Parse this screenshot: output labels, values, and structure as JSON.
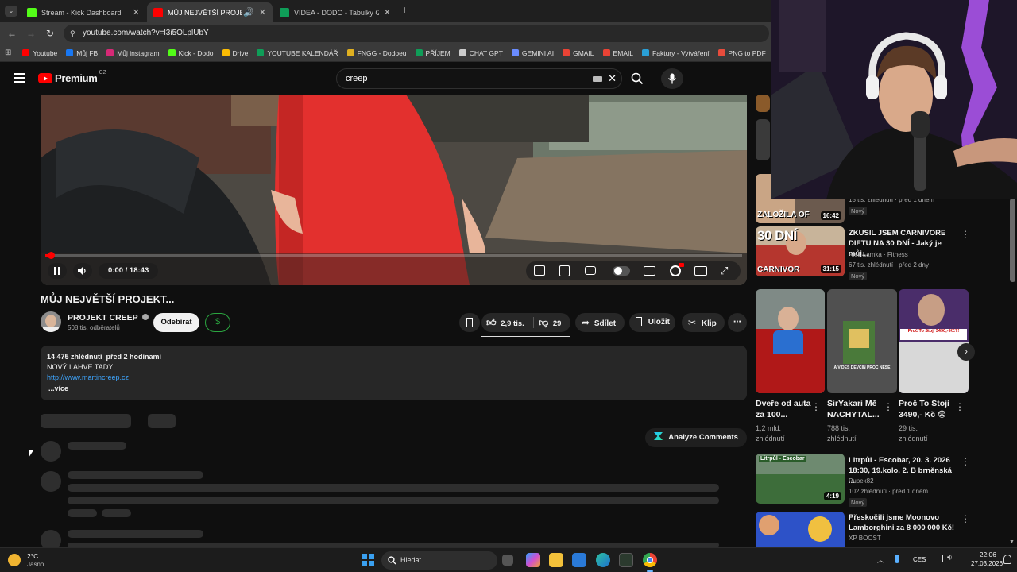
{
  "browser": {
    "tabs": [
      {
        "label": "Stream - Kick Dashboard",
        "color": "#53fc18"
      },
      {
        "label": "MŮJ NEJVĚTŠÍ PROJEKT...",
        "color": "#ff0000"
      },
      {
        "label": "VIDEA - DODO - Tabulky Googl",
        "color": "#0f9d58"
      }
    ],
    "new_tab": "+",
    "url": "youtube.com/watch?v=l3i5OLplUbY",
    "bookmarks": [
      {
        "label": "Youtube",
        "color": "#ff0000"
      },
      {
        "label": "Můj FB",
        "color": "#1877f2"
      },
      {
        "label": "Můj instagram",
        "color": "#d62976"
      },
      {
        "label": "Kick - Dodo",
        "color": "#53fc18"
      },
      {
        "label": "Drive",
        "color": "#fbbc04"
      },
      {
        "label": "YOUTUBE KALENDÁŘ",
        "color": "#0f9d58"
      },
      {
        "label": "FNGG - Dodoeu",
        "color": "#e0b020"
      },
      {
        "label": "PŘÍJEM",
        "color": "#0f9d58"
      },
      {
        "label": "CHAT GPT",
        "color": "#cccccc"
      },
      {
        "label": "GEMINI AI",
        "color": "#6a8cff"
      },
      {
        "label": "GMAIL",
        "color": "#ea4335"
      },
      {
        "label": "EMAIL",
        "color": "#ea4335"
      },
      {
        "label": "Faktury - Vytváření",
        "color": "#2a9fd6"
      },
      {
        "label": "PNG to PDF",
        "color": "#e74c3c"
      }
    ]
  },
  "youtube": {
    "logo": "Premium",
    "region": "CZ",
    "search_value": "creep",
    "player": {
      "time": "0:00 / 18:43",
      "progress": 0.003
    },
    "title": "MŮJ NEJVĚTŠÍ PROJEKT...",
    "channel": {
      "name": "PROJEKT CREEP",
      "subs": "508 tis. odběratelů"
    },
    "subscribe": "Odebírat",
    "likes": "2,9 tis.",
    "dislikes": "29",
    "share": "Sdílet",
    "save": "Uložit",
    "clip": "Klip",
    "description": {
      "stats": "14 475 zhlédnutí  před 2 hodinami",
      "line1": "NOVÝ LAHVE TADY!",
      "link": "http://www.martincreep.cz",
      "more": "...více"
    },
    "analyze": "Analyze Comments"
  },
  "sidebar": {
    "partial": {
      "meta": "18 tis. zhlédnutí · před 1 dnem",
      "duration": "16:42",
      "badge": "Nový",
      "thumb_text": "ZALOŽILA OF"
    },
    "items": [
      {
        "title": "ZKUSIL JSEM CARNIVORE DIETU NA 30 DNÍ - Jaký je můj...",
        "channel": "Aleš Lamka · Fitness",
        "meta": "67 tis. zhlédnutí · před 2 dny",
        "badge": "Nový",
        "duration": "31:15",
        "thumb_text": "30 DNÍ",
        "thumb_text2": "CARNIVOR"
      },
      {
        "title": "Litrpůl - Escobar, 20. 3. 2026 18:30, 19.kolo, 2. B brněnská ...",
        "channel": "Pupek82",
        "meta": "102 zhlédnutí · před 1 dnem",
        "badge": "Nový",
        "duration": "4:19"
      },
      {
        "title": "Přeskočili jsme Moonovo Lamborghini za 8 000 000 Kč!",
        "channel": "XP BOOST"
      }
    ],
    "shorts": [
      {
        "title": "Dveře od auta za 100...",
        "meta": "1,2 mld. zhlédnutí"
      },
      {
        "title": "SirYakari Mě NACHYTAL...",
        "meta": "788 tis. zhlédnutí"
      },
      {
        "title": "Proč To Stojí 3490,- Kč 😨",
        "meta": "29 tis. zhlédnutí"
      }
    ]
  },
  "taskbar": {
    "temp": "2°C",
    "weather": "Jasno",
    "search": "Hledat",
    "lang": "CES",
    "time": "22:06",
    "date": "27.03.2026"
  }
}
